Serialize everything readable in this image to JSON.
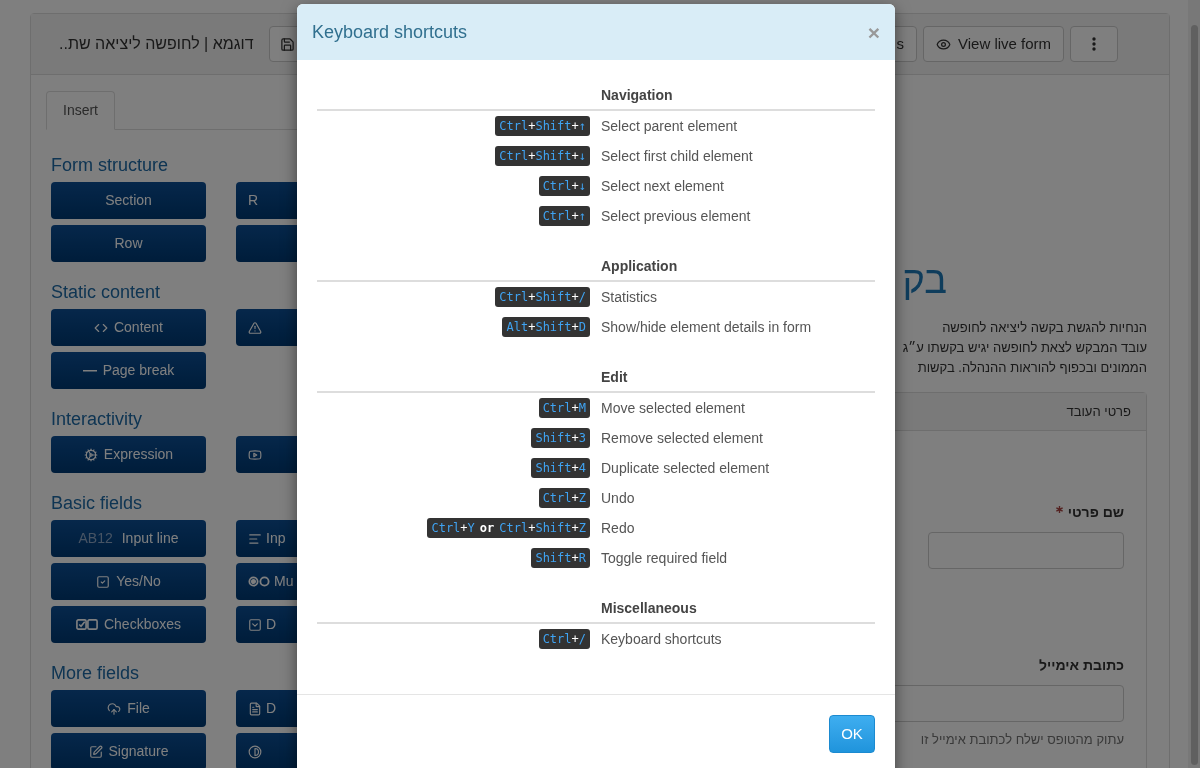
{
  "app": {
    "title": "דוגמא | לחופשה ליציאה שת..",
    "toolbar": [
      {
        "kind": "save"
      },
      {
        "kind": "text",
        "label": "s"
      },
      {
        "kind": "eye",
        "label": "View live form"
      },
      {
        "kind": "more"
      }
    ],
    "tabs": [
      {
        "label": "Insert",
        "selected": true
      }
    ],
    "groups": [
      {
        "title": "Form structure",
        "buttons": [
          {
            "kind": "plain",
            "label": "Section"
          },
          {
            "kind": "plain",
            "label": "R"
          },
          {
            "kind": "plain",
            "label": "Row"
          },
          {
            "kind": "plain"
          }
        ]
      },
      {
        "title": "Static content",
        "buttons": [
          {
            "label": "Content",
            "kind": "code"
          },
          {
            "kind": "warning"
          },
          {
            "label": "Page break",
            "kind": "dash"
          }
        ]
      },
      {
        "title": "Interactivity",
        "buttons": [
          {
            "label": "Expression",
            "kind": "gears"
          },
          {
            "kind": "video"
          }
        ]
      },
      {
        "title": "Basic fields",
        "buttons": [
          {
            "kind": "plain",
            "label": "Input line",
            "prefix": "AB12"
          },
          {
            "label": "Inp",
            "kind": "lines"
          },
          {
            "label": "Yes/No",
            "kind": "check"
          },
          {
            "label": "Mu",
            "kind": "radios"
          },
          {
            "label": "Checkboxes",
            "kind": "checkboxes"
          },
          {
            "label": "D",
            "kind": "dropdown"
          }
        ]
      },
      {
        "title": "More fields",
        "buttons": [
          {
            "label": "File",
            "kind": "upload"
          },
          {
            "label": "D",
            "kind": "document"
          },
          {
            "label": "Signature",
            "kind": "pen"
          },
          {
            "kind": "halfcircle"
          }
        ]
      }
    ],
    "page": {
      "heading": "בק",
      "intro": [
        "הנחיות להגשת בקשה ליציאה לחופשה",
        "עובד המבקש לצאת לחופשה יגיש בקשתו ע״ג",
        "הממונים ובכפוף להוראות ההנהלה. בקשות"
      ],
      "card": {
        "title": "פרטי העובד",
        "fields": [
          {
            "label": "שם פרטי",
            "required": true
          },
          {
            "label": "כתובת אימייל",
            "required": false,
            "help": "עתוק מהטופס ישלח לכתובת אימייל זו"
          }
        ]
      }
    }
  },
  "dialog": {
    "title": "Keyboard shortcuts",
    "close": "×",
    "sections": [
      {
        "title": "Navigation",
        "shortcuts": [
          {
            "keys": [
              {
                "kind": "key",
                "text": "Ctrl"
              },
              {
                "kind": "plus",
                "text": "+"
              },
              {
                "kind": "key",
                "text": "Shift"
              },
              {
                "kind": "plus",
                "text": "+"
              },
              {
                "kind": "key",
                "text": "↑"
              }
            ],
            "description": "Select parent element"
          },
          {
            "keys": [
              {
                "kind": "key",
                "text": "Ctrl"
              },
              {
                "kind": "plus",
                "text": "+"
              },
              {
                "kind": "key",
                "text": "Shift"
              },
              {
                "kind": "plus",
                "text": "+"
              },
              {
                "kind": "key",
                "text": "↓"
              }
            ],
            "description": "Select first child element"
          },
          {
            "keys": [
              {
                "kind": "key",
                "text": "Ctrl"
              },
              {
                "kind": "plus",
                "text": "+"
              },
              {
                "kind": "key",
                "text": "↓"
              }
            ],
            "description": "Select next element"
          },
          {
            "keys": [
              {
                "kind": "key",
                "text": "Ctrl"
              },
              {
                "kind": "plus",
                "text": "+"
              },
              {
                "kind": "key",
                "text": "↑"
              }
            ],
            "description": "Select previous element"
          }
        ]
      },
      {
        "title": "Application",
        "shortcuts": [
          {
            "keys": [
              {
                "kind": "key",
                "text": "Ctrl"
              },
              {
                "kind": "plus",
                "text": "+"
              },
              {
                "kind": "key",
                "text": "Shift"
              },
              {
                "kind": "plus",
                "text": "+"
              },
              {
                "kind": "key",
                "text": "/"
              }
            ],
            "description": "Statistics"
          },
          {
            "keys": [
              {
                "kind": "key",
                "text": "Alt"
              },
              {
                "kind": "plus",
                "text": "+"
              },
              {
                "kind": "key",
                "text": "Shift"
              },
              {
                "kind": "plus",
                "text": "+"
              },
              {
                "kind": "key",
                "text": "D"
              }
            ],
            "description": "Show/hide element details in form"
          }
        ]
      },
      {
        "title": "Edit",
        "shortcuts": [
          {
            "keys": [
              {
                "kind": "key",
                "text": "Ctrl"
              },
              {
                "kind": "plus",
                "text": "+"
              },
              {
                "kind": "key",
                "text": "M"
              }
            ],
            "description": "Move selected element"
          },
          {
            "keys": [
              {
                "kind": "key",
                "text": "Shift"
              },
              {
                "kind": "plus",
                "text": "+"
              },
              {
                "kind": "key",
                "text": "3"
              }
            ],
            "description": "Remove selected element"
          },
          {
            "keys": [
              {
                "kind": "key",
                "text": "Shift"
              },
              {
                "kind": "plus",
                "text": "+"
              },
              {
                "kind": "key",
                "text": "4"
              }
            ],
            "description": "Duplicate selected element"
          },
          {
            "keys": [
              {
                "kind": "key",
                "text": "Ctrl"
              },
              {
                "kind": "plus",
                "text": "+"
              },
              {
                "kind": "key",
                "text": "Z"
              }
            ],
            "description": "Undo"
          },
          {
            "keys": [
              {
                "kind": "key",
                "text": "Ctrl"
              },
              {
                "kind": "plus",
                "text": "+"
              },
              {
                "kind": "key",
                "text": "Y"
              },
              {
                "kind": "word",
                "text": "or"
              },
              {
                "kind": "key",
                "text": "Ctrl"
              },
              {
                "kind": "plus",
                "text": "+"
              },
              {
                "kind": "key",
                "text": "Shift"
              },
              {
                "kind": "plus",
                "text": "+"
              },
              {
                "kind": "key",
                "text": "Z"
              }
            ],
            "description": "Redo"
          },
          {
            "keys": [
              {
                "kind": "key",
                "text": "Shift"
              },
              {
                "kind": "plus",
                "text": "+"
              },
              {
                "kind": "key",
                "text": "R"
              }
            ],
            "description": "Toggle required field"
          }
        ]
      },
      {
        "title": "Miscellaneous",
        "shortcuts": [
          {
            "keys": [
              {
                "kind": "key",
                "text": "Ctrl"
              },
              {
                "kind": "plus",
                "text": "+"
              },
              {
                "kind": "key",
                "text": "/"
              }
            ],
            "description": "Keyboard shortcuts"
          }
        ]
      }
    ],
    "ok": "OK"
  }
}
